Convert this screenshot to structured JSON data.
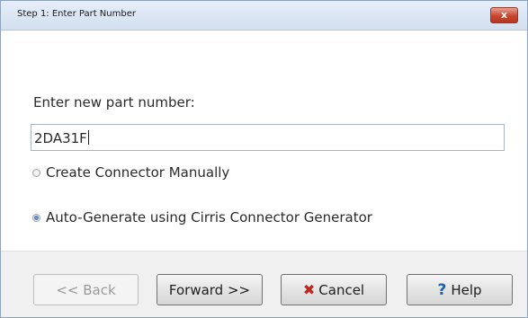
{
  "window": {
    "title": "Step 1: Enter Part Number",
    "close_glyph": "x"
  },
  "form": {
    "prompt_label": "Enter new part number:",
    "part_number_value": "2DA31F",
    "options": [
      {
        "label": "Create Connector Manually",
        "selected": false
      },
      {
        "label": "Auto-Generate using Cirris Connector Generator",
        "selected": true
      }
    ]
  },
  "buttons": {
    "back_label": "<< Back",
    "forward_label": "Forward >>",
    "cancel_label": "Cancel",
    "cancel_icon": "x-icon",
    "help_label": "Help",
    "help_icon": "question-icon"
  },
  "colors": {
    "title_bar": "#d3dff0",
    "close_button": "#c7452e",
    "cancel_icon": "#c0261b",
    "help_icon": "#1f5fb4",
    "radio_selected": "#2c5ea8"
  }
}
